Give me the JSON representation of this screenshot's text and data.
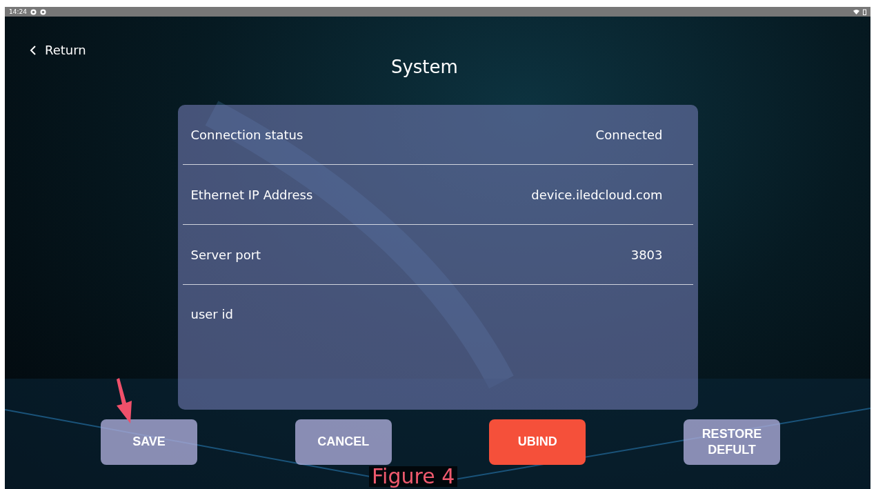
{
  "status_bar": {
    "time": "14:24"
  },
  "header": {
    "back_label": "Return",
    "title": "System"
  },
  "settings": [
    {
      "label": "Connection status",
      "value": "Connected"
    },
    {
      "label": "Ethernet IP Address",
      "value": "device.iledcloud.com"
    },
    {
      "label": "Server port",
      "value": "3803"
    },
    {
      "label": "user id"
    }
  ],
  "buttons": [
    {
      "label": "SAVE",
      "kind": "normal"
    },
    {
      "label": "CANCEL",
      "kind": "normal"
    },
    {
      "label": "UBIND",
      "kind": "danger"
    },
    {
      "label": "RESTORE DEFULT",
      "kind": "normal"
    }
  ],
  "annotation": {
    "caption": "Figure  4"
  }
}
